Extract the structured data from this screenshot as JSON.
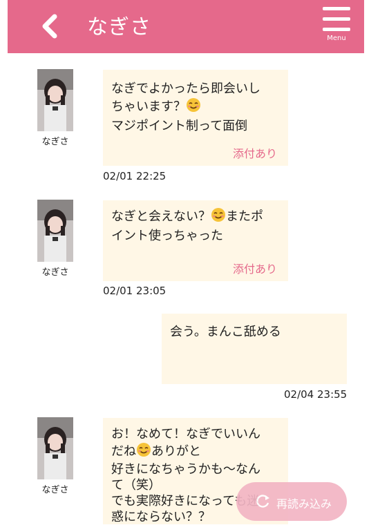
{
  "header": {
    "title": "なぎさ",
    "menu_label": "Menu",
    "accent_color": "#e5698b"
  },
  "messages": [
    {
      "sender": "なぎさ",
      "text_lines": [
        "なぎでよかったら即会いし",
        "ちゃいます？",
        "マジポイント制って面倒"
      ],
      "emoji": "smiling-face-emoji",
      "attachment": "添付あり",
      "time": "02/01 22:25"
    },
    {
      "sender": "なぎさ",
      "text_lines": [
        "なぎと会えない？",
        "またポ",
        "イント使っちゃった"
      ],
      "emoji": "smiling-face-emoji",
      "attachment": "添付あり",
      "time": "02/01 23:05"
    },
    {
      "sender": "self",
      "text_lines": [
        "会う。まんこ舐める"
      ],
      "time": "02/04 23:55"
    },
    {
      "sender": "なぎさ",
      "text_lines": [
        "お！なめて！なぎでいいん",
        "だね",
        "ありがと",
        "好きになちゃうかも〜なん",
        "て（笑）",
        "でも実際好きになっても迷",
        "惑にならない？？"
      ],
      "emoji": "smiling-face-emoji"
    }
  ],
  "reload_button": {
    "label": "再読み込み",
    "icon": "reload-icon"
  }
}
